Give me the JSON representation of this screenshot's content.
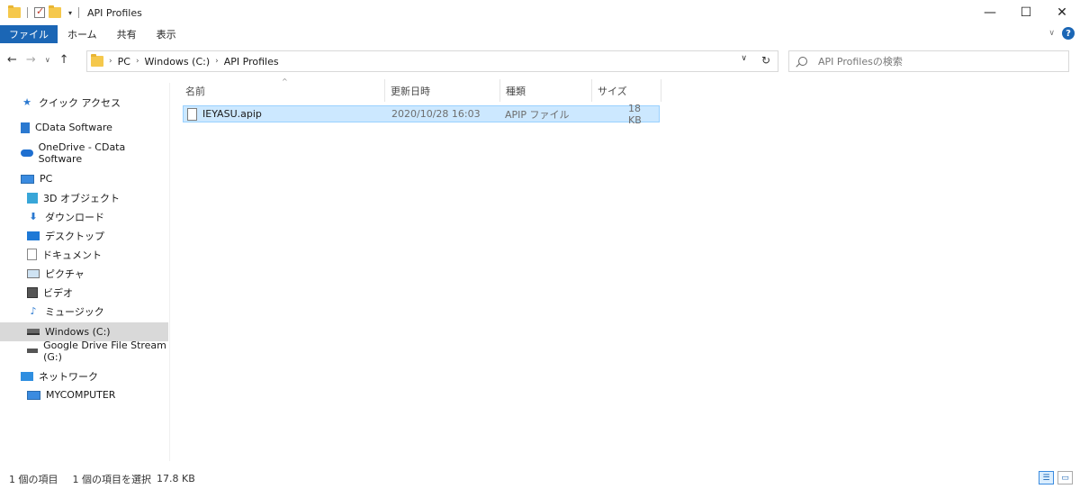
{
  "window": {
    "title": "API Profiles",
    "controls": {
      "minimize": "—",
      "maximize": "☐",
      "close": "✕"
    }
  },
  "ribbon": {
    "tabs": [
      "ファイル",
      "ホーム",
      "共有",
      "表示"
    ],
    "collapse_icon": "∨",
    "help_icon": "?"
  },
  "nav_buttons": {
    "back": "←",
    "forward": "→",
    "recent": "∨",
    "up": "↑"
  },
  "address": {
    "path": [
      "PC",
      "Windows (C:)",
      "API Profiles"
    ],
    "separator": "›",
    "dropdown": "∨",
    "refresh": "↻"
  },
  "search": {
    "placeholder": "API Profilesの検索"
  },
  "navpane": {
    "items": [
      {
        "label": "クイック アクセス",
        "icon": "star-icon"
      },
      {
        "label": "CData Software",
        "icon": "building-icon"
      },
      {
        "label": "OneDrive - CData Software",
        "icon": "cloud-icon"
      },
      {
        "label": "PC",
        "icon": "pc-icon"
      },
      {
        "label": "3D オブジェクト",
        "icon": "cube-icon"
      },
      {
        "label": "ダウンロード",
        "icon": "download-icon"
      },
      {
        "label": "デスクトップ",
        "icon": "desktop-icon"
      },
      {
        "label": "ドキュメント",
        "icon": "document-icon"
      },
      {
        "label": "ピクチャ",
        "icon": "picture-icon"
      },
      {
        "label": "ビデオ",
        "icon": "video-icon"
      },
      {
        "label": "ミュージック",
        "icon": "music-icon"
      },
      {
        "label": "Windows (C:)",
        "icon": "drive-icon"
      },
      {
        "label": "Google Drive File Stream (G:)",
        "icon": "drive-icon"
      },
      {
        "label": "ネットワーク",
        "icon": "network-icon"
      },
      {
        "label": "MYCOMPUTER",
        "icon": "monitor-icon"
      }
    ]
  },
  "content": {
    "columns": [
      "名前",
      "更新日時",
      "種類",
      "サイズ"
    ],
    "sort_indicator": "^",
    "files": [
      {
        "name": "IEYASU.apip",
        "modified": "2020/10/28 16:03",
        "type": "APIP ファイル",
        "size": "18 KB"
      }
    ]
  },
  "status": {
    "count": "1 個の項目",
    "selected": "1 個の項目を選択",
    "size": "17.8 KB"
  }
}
